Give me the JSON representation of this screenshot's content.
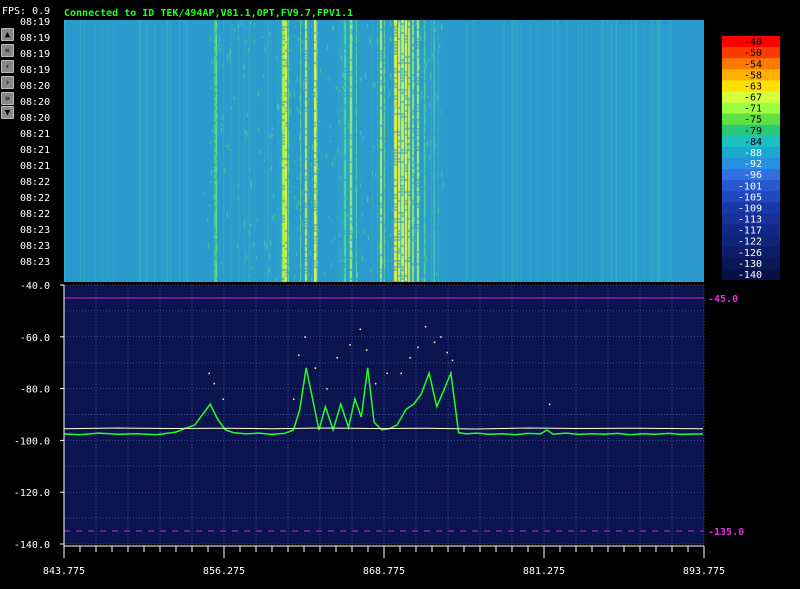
{
  "header": {
    "fps": "FPS: 0.9",
    "status": "Connected to ID TEK/494AP,V81.1,OPT,FV9.7,FPV1.1"
  },
  "nav_buttons": [
    {
      "name": "scroll-up-button",
      "glyph": "▲",
      "icon": "up-icon"
    },
    {
      "name": "rewind-button",
      "glyph": "«",
      "icon": "rewind-icon"
    },
    {
      "name": "step-back-button",
      "glyph": "‹",
      "icon": "back-icon"
    },
    {
      "name": "step-forward-button",
      "glyph": "›",
      "icon": "forward-icon"
    },
    {
      "name": "fast-forward-button",
      "glyph": "»",
      "icon": "fast-forward-icon"
    },
    {
      "name": "scroll-down-button",
      "glyph": "▼",
      "icon": "down-icon"
    }
  ],
  "waterfall": {
    "timestamps": [
      "08:19",
      "08:19",
      "08:19",
      "08:19",
      "08:20",
      "08:20",
      "08:20",
      "08:21",
      "08:21",
      "08:21",
      "08:22",
      "08:22",
      "08:22",
      "08:23",
      "08:23",
      "08:23"
    ]
  },
  "colorbar": {
    "levels": [
      "-40",
      "-50",
      "-54",
      "-58",
      "-63",
      "-67",
      "-71",
      "-75",
      "-79",
      "-84",
      "-88",
      "-92",
      "-96",
      "-101",
      "-105",
      "-109",
      "-113",
      "-117",
      "-122",
      "-126",
      "-130",
      "-140"
    ],
    "colors": [
      "#ff0000",
      "#ff3a00",
      "#ff7a00",
      "#ffb000",
      "#ffe000",
      "#d6ff3c",
      "#9cff40",
      "#5ee040",
      "#28c878",
      "#1cc0c0",
      "#18a8d0",
      "#2890e0",
      "#3070e0",
      "#2858d0",
      "#2048c0",
      "#1838a8",
      "#183098",
      "#102888",
      "#102478",
      "#0c1c68",
      "#0a1858",
      "#081048"
    ]
  },
  "spectrum": {
    "markers": {
      "top_value": "-45.0",
      "bottom_value": "-135.0",
      "top_db": -45,
      "bottom_db": -135
    }
  },
  "chart_data": {
    "type": "line",
    "title": "",
    "xlabel": "",
    "ylabel": "",
    "xlim": [
      843.775,
      893.775
    ],
    "ylim": [
      -140,
      -40
    ],
    "xticks": [
      "843.775",
      "856.275",
      "868.775",
      "881.275",
      "893.775"
    ],
    "yticks": [
      "-40.0",
      "-60.0",
      "-80.0",
      "-100.0",
      "-120.0",
      "-140.0"
    ],
    "grid": true,
    "series": [
      {
        "color": "#22ff22",
        "style": "line",
        "x": [
          843.8,
          845,
          846.5,
          848,
          849.5,
          851,
          852.5,
          853.2,
          854,
          854.6,
          855.2,
          855.8,
          856.4,
          857,
          858,
          859,
          860,
          861,
          861.7,
          862.2,
          862.7,
          863.2,
          863.7,
          864.2,
          864.8,
          865.4,
          866,
          866.5,
          867,
          867.5,
          868,
          868.6,
          869.2,
          869.8,
          870.5,
          871.1,
          871.7,
          872.3,
          872.9,
          873.5,
          874,
          874.6,
          875.2,
          876,
          877,
          878,
          879,
          880,
          881,
          881.5,
          882,
          883,
          884,
          885,
          886,
          887,
          888,
          889,
          890,
          891,
          892,
          893.7
        ],
        "y": [
          -97.5,
          -97.8,
          -97.2,
          -97.6,
          -97.4,
          -97.8,
          -96.8,
          -95.5,
          -94,
          -90,
          -86,
          -92,
          -96,
          -97,
          -97.5,
          -97.2,
          -97.7,
          -97.3,
          -96,
          -88,
          -72,
          -84,
          -96,
          -87,
          -96,
          -86,
          -95,
          -84,
          -91,
          -72,
          -93,
          -96,
          -95.5,
          -94,
          -88,
          -86,
          -82,
          -74,
          -87,
          -80,
          -74,
          -97,
          -97.5,
          -97.2,
          -97.6,
          -97.4,
          -97.8,
          -97.3,
          -97.5,
          -96,
          -97.6,
          -97.2,
          -97.7,
          -97.4,
          -97.6,
          -97.3,
          -97.8,
          -97.4,
          -97.6,
          -97.3,
          -97.7,
          -97.5
        ]
      },
      {
        "color": "#ffffcc",
        "style": "line",
        "x": [
          843.8,
          848,
          852,
          856,
          860,
          864,
          868,
          872,
          876,
          880,
          884,
          888,
          893.7
        ],
        "y": [
          -95.5,
          -95.2,
          -95.4,
          -95.3,
          -95.5,
          -95.2,
          -95.4,
          -95.3,
          -95.6,
          -95.2,
          -95.4,
          -95.3,
          -95.5
        ]
      },
      {
        "color": "#ffffaa",
        "style": "points",
        "x": [
          855.1,
          855.5,
          856.2,
          861.7,
          862.1,
          862.6,
          863.4,
          864.3,
          865.1,
          866.1,
          866.9,
          867.4,
          868.1,
          869.0,
          870.1,
          870.8,
          871.4,
          872.0,
          872.7,
          873.2,
          873.7,
          874.1,
          881.7
        ],
        "y": [
          -74,
          -78,
          -84,
          -84,
          -67,
          -60,
          -72,
          -80,
          -68,
          -63,
          -57,
          -65,
          -78,
          -74,
          -74,
          -68,
          -64,
          -56,
          -62,
          -60,
          -66,
          -69,
          -86
        ]
      }
    ]
  }
}
